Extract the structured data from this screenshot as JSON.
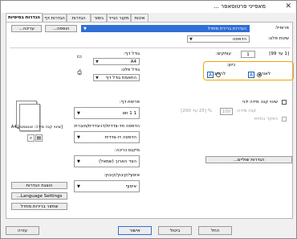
{
  "window": {
    "title": "מאפייני פרטוסאפר ..."
  },
  "tabs": [
    {
      "label": "הגדרות בסיסיות",
      "active": true
    },
    {
      "label": "הגדרות דף"
    },
    {
      "label": "הגדרות עמוד"
    },
    {
      "label": "גימור"
    },
    {
      "label": "מקור הנייר"
    },
    {
      "label": "איכות"
    }
  ],
  "profile": {
    "label": "פרופיל:",
    "value": "הגדרות ברירת מחדל",
    "add_label": "הוספה...",
    "edit_label": "עריכה..."
  },
  "output_method": {
    "label": "שיטת פלט:",
    "value": "הדפסה"
  },
  "page_size": {
    "label": "גודל דף:",
    "value": "A4"
  },
  "output_size": {
    "label": "גודל פלט:",
    "value": "התאמת גודל דף"
  },
  "copies": {
    "label": "עותקים:",
    "value": "1",
    "range": "[1 עד 99]"
  },
  "orientation": {
    "label": "כיוון:",
    "portrait_label": "לאורך",
    "landscape_label": "לרוחב",
    "selected": "portrait",
    "portrait_icon": "A",
    "landscape_icon": "A"
  },
  "page_layout": {
    "label": "פריסת דף:",
    "value": "1 on 1"
  },
  "manual_scaling": {
    "label": "שינוי קנה מידה ידני",
    "scale_label": "קנה מידה:",
    "scale_value": "100",
    "scale_range": "% [25 עד 200]",
    "margin_label": "הפקד בחזית"
  },
  "duplex": {
    "label": "הדפסה חד-צדדית/דו-צדדית/חוברת:",
    "value": "הדפסה דו-צדדית"
  },
  "binding": {
    "label": "מיקום כריכה:",
    "value": "הצד הארוך (שמאל)"
  },
  "binding_settings_label": "הגדרות שוליים...",
  "collate": {
    "label": "איסוף/קיבוץ/קיבוץ:",
    "value": "איסוף"
  },
  "preview": {
    "paper_caption": "[שינוי קנה מידה: אוטומטי] A4"
  },
  "side_buttons": {
    "print_quality": "הוצגת הגדרות",
    "language": "Language Settings...",
    "restore_defaults": "שחזור ברירות מחדל"
  },
  "footer": {
    "ok": "אישור",
    "cancel": "ביטול",
    "apply": "החל",
    "help": "עזרה"
  },
  "colors": {
    "accent": "#2f6fd6",
    "highlight": "#f0a500",
    "icon_blue": "#1a5fb4"
  }
}
